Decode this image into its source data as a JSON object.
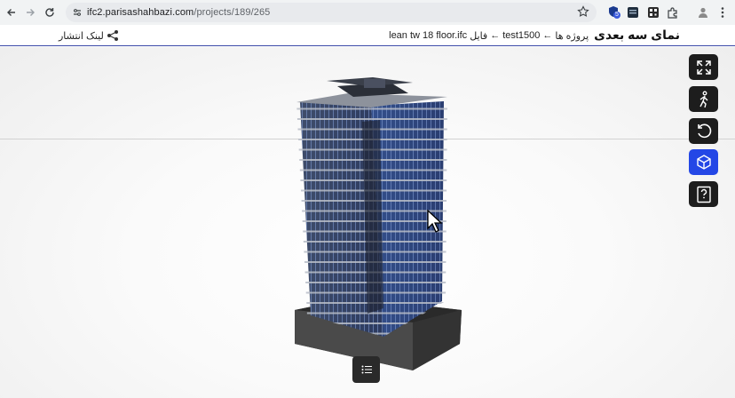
{
  "browser": {
    "url_host": "ifc2.parisashahbazi.com",
    "url_path": "/projects/189/265",
    "extension_badge": "5"
  },
  "header": {
    "share_label": "لینک انتشار",
    "page_title": "نمای سه بعدی",
    "breadcrumb": {
      "projects": "پروژه ها",
      "project": "test1500",
      "file_label": "فایل",
      "file_name": "lean tw 18 floor.ifc",
      "separator": "←"
    }
  },
  "toolbar": {
    "tools": [
      {
        "name": "fullscreen",
        "icon": "expand-icon",
        "active": false
      },
      {
        "name": "walk",
        "icon": "walk-icon",
        "active": false
      },
      {
        "name": "reset",
        "icon": "reset-icon",
        "active": false
      },
      {
        "name": "model",
        "icon": "cube-icon",
        "active": true
      },
      {
        "name": "help",
        "icon": "help-book-icon",
        "active": false
      }
    ]
  },
  "colors": {
    "accent": "#2447e6",
    "header_underline": "#3b4aa8",
    "tool_bg": "#1d1d1d"
  }
}
